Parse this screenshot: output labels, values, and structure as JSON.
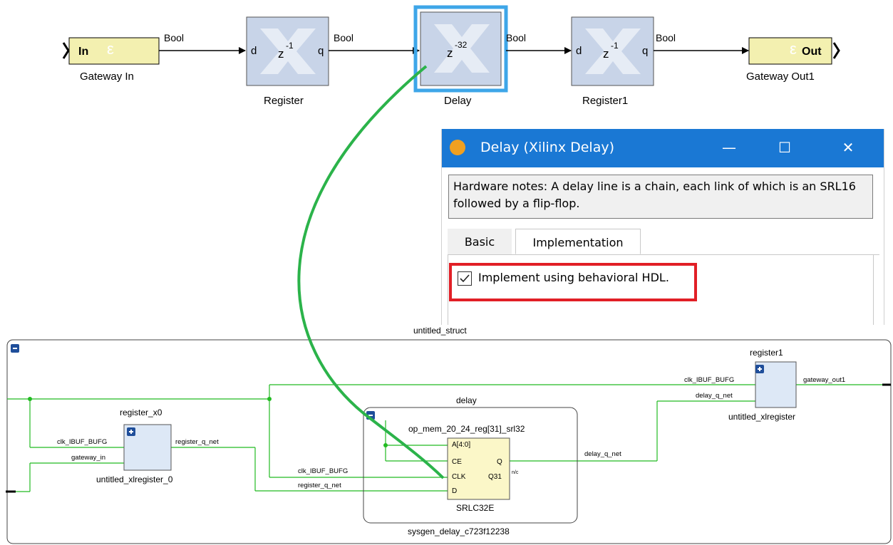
{
  "diagram": {
    "signal_type": "Bool",
    "gateway_in": {
      "port_label": "In",
      "caption": "Gateway In"
    },
    "register": {
      "caption": "Register",
      "port_in": "d",
      "port_out": "q",
      "op": "z",
      "exp": "-1"
    },
    "delay": {
      "caption": "Delay",
      "op": "z",
      "exp": "-32"
    },
    "register1": {
      "caption": "Register1",
      "port_in": "d",
      "port_out": "q",
      "op": "z",
      "exp": "-1"
    },
    "gateway_out": {
      "port_label": "Out",
      "caption": "Gateway Out1"
    },
    "colors": {
      "block_fill": "#c8d4e8",
      "gateway_fill": "#f3f0b0",
      "highlight_blue": "#3ea6e8",
      "annotation_green": "#2bb34a",
      "net_green": "#22bb22"
    }
  },
  "dialog": {
    "title": "Delay (Xilinx Delay)",
    "minimize_icon": "minimize-icon",
    "maximize_icon": "maximize-icon",
    "close_icon": "close-icon",
    "notes": "Hardware notes: A delay line is a chain, each link of which is an SRL16 followed by a flip-flop.",
    "tabs": [
      "Basic",
      "Implementation"
    ],
    "active_tab": "Implementation",
    "checkbox_label": "Implement using behavioral HDL.",
    "checkbox_checked": true,
    "highlight_color": "#e11f26"
  },
  "schematic": {
    "top_label": "untitled_struct",
    "register_x0": {
      "name": "register_x0",
      "cell": "untitled_xlregister_0",
      "pin_clk": "clk_IBUF_BUFG",
      "pin_in": "gateway_in",
      "pin_out": "register_q_net"
    },
    "delay_group": {
      "name": "delay",
      "cell": "sysgen_delay_c723f12238"
    },
    "srl": {
      "name": "op_mem_20_24_reg[31]_srl32",
      "type": "SRLC32E",
      "pins_left": [
        "A[4:0]",
        "CE",
        "CLK",
        "D"
      ],
      "pins_right": [
        "Q",
        "Q31"
      ],
      "nc": "n/c"
    },
    "nets": {
      "clk": "clk_IBUF_BUFG",
      "reg_q": "register_q_net",
      "delay_q": "delay_q_net",
      "delay_q_right": "delay_q_net",
      "clk_right": "clk_IBUF_BUFG",
      "gw_out": "gateway_out1"
    },
    "register1": {
      "name": "register1",
      "cell": "untitled_xlregister"
    }
  }
}
